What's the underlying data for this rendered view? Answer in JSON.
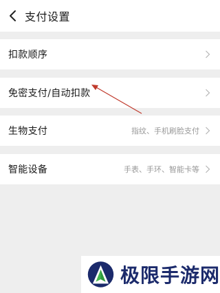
{
  "header": {
    "title": "支付设置",
    "back_icon": "chevron-left-icon"
  },
  "settings": [
    {
      "label": "扣款顺序",
      "value": ""
    },
    {
      "label": "免密支付/自动扣款",
      "value": ""
    },
    {
      "label": "生物支付",
      "value": "指纹、手机刷脸支付"
    },
    {
      "label": "智能设备",
      "value": "手表、手环、智能卡等"
    }
  ],
  "colors": {
    "background": "#eeeeee",
    "row_background": "#ffffff",
    "secondary_text": "#999999",
    "annotation_arrow": "#c0392b",
    "watermark_text": "#1b2a6b"
  },
  "watermark": {
    "text": "极限手游网"
  }
}
